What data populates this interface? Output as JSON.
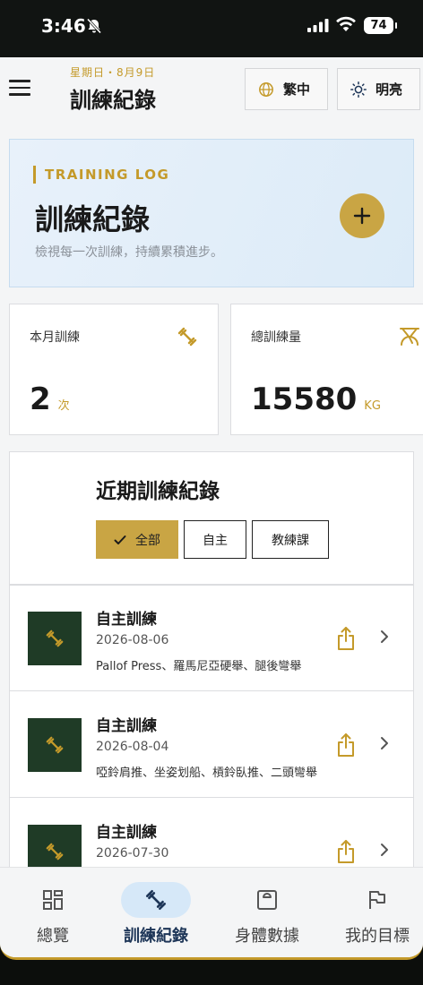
{
  "status_bar": {
    "time": "3:46",
    "battery": "74"
  },
  "header": {
    "hamburger_icon": "menu-icon",
    "date": "星期日・8月9日",
    "title": "訓練紀錄",
    "lang_button": {
      "icon": "globe-icon",
      "label": "繁中"
    },
    "theme_button": {
      "icon": "sun-icon",
      "label": "明亮"
    }
  },
  "hero": {
    "kicker": "TRAINING LOG",
    "title": "訓練紀錄",
    "subtitle": "檢視每一次訓練，持續累積進步。",
    "add_icon": "plus-icon"
  },
  "stats": [
    {
      "label": "本月訓練",
      "value": "2",
      "unit": "次",
      "icon": "dumbbell-icon"
    },
    {
      "label": "總訓練量",
      "value": "15580",
      "unit": "KG",
      "icon": "scale-icon"
    }
  ],
  "records": {
    "title": "近期訓練紀錄",
    "filters": [
      {
        "label": "全部",
        "selected": true
      },
      {
        "label": "自主",
        "selected": false
      },
      {
        "label": "教練課",
        "selected": false
      }
    ],
    "items": [
      {
        "title": "自主訓練",
        "date": "2026-08-06",
        "exercises": "Pallof Press、羅馬尼亞硬舉、腿後彎舉"
      },
      {
        "title": "自主訓練",
        "date": "2026-08-04",
        "exercises": "啞鈴肩推、坐姿划船、槓鈴臥推、二頭彎舉"
      },
      {
        "title": "自主訓練",
        "date": "2026-07-30",
        "exercises": ""
      }
    ]
  },
  "tabbar": [
    {
      "label": "總覽",
      "icon": "grid-icon",
      "active": false
    },
    {
      "label": "訓練紀錄",
      "icon": "dumbbell-icon",
      "active": true
    },
    {
      "label": "身體數據",
      "icon": "scale-icon",
      "active": false
    },
    {
      "label": "我的目標",
      "icon": "flag-icon",
      "active": false
    }
  ],
  "colors": {
    "accent": "#c9a544",
    "dark_green": "#1f3b26",
    "active_tab_bg": "#d6e8f8",
    "active_tab_text": "#1d3557"
  }
}
